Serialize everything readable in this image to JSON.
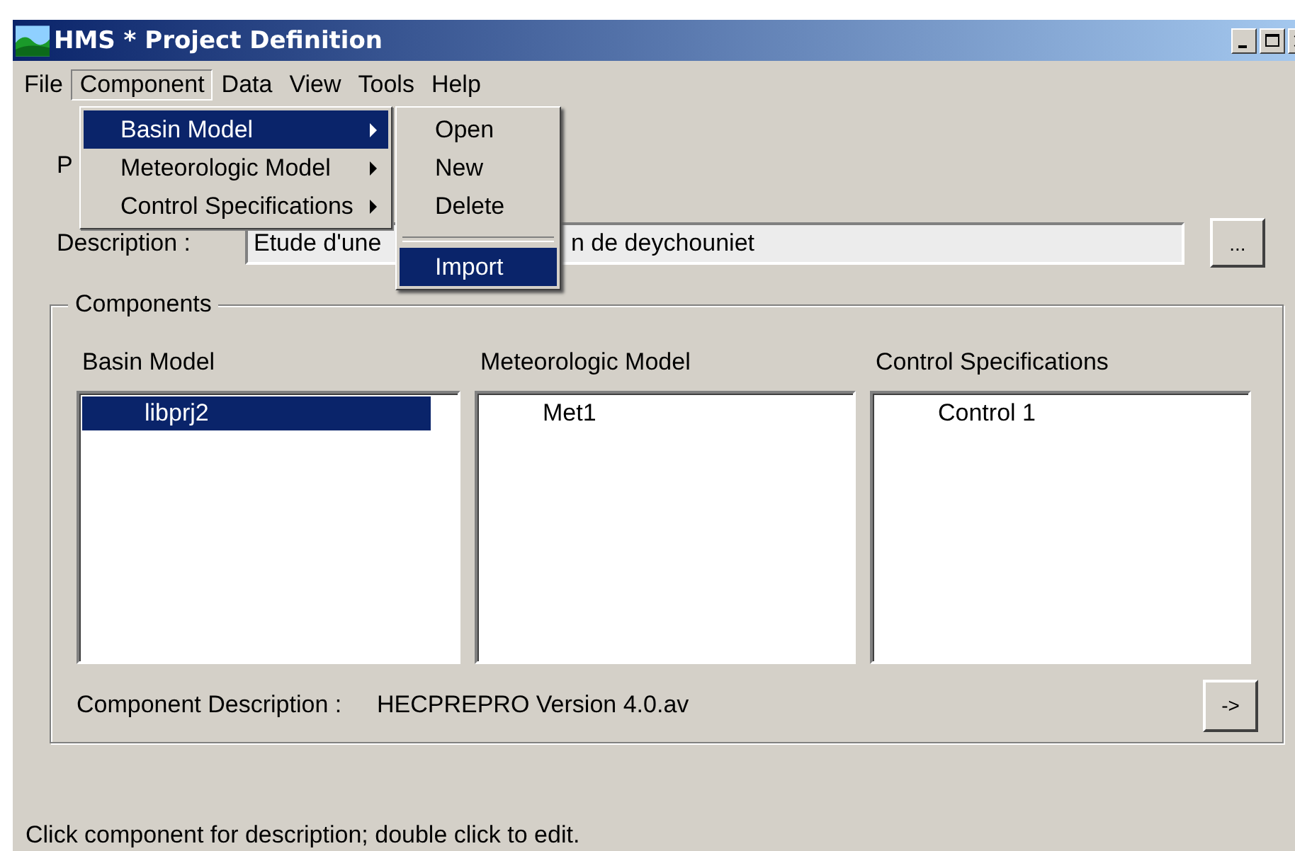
{
  "window": {
    "title": "HMS * Project Definition"
  },
  "menu_bar": [
    {
      "label": "File",
      "selected": false
    },
    {
      "label": "Component",
      "selected": true
    },
    {
      "label": "Data",
      "selected": false
    },
    {
      "label": "View",
      "selected": false
    },
    {
      "label": "Tools",
      "selected": false
    },
    {
      "label": "Help",
      "selected": false
    }
  ],
  "component_menu": [
    {
      "label": "Basin Model",
      "selected": true
    },
    {
      "label": "Meteorologic Model",
      "selected": false
    },
    {
      "label": "Control Specifications",
      "selected": false
    }
  ],
  "submenu": [
    {
      "kind": "item",
      "label": "Open",
      "selected": false
    },
    {
      "kind": "item",
      "label": "New",
      "selected": false
    },
    {
      "kind": "item",
      "label": "Delete",
      "selected": false
    },
    {
      "kind": "separator"
    },
    {
      "kind": "item",
      "label": "Import",
      "selected": true
    }
  ],
  "project_label": "P",
  "description": {
    "label": "Description :",
    "value_parts": [
      "Etude d'une",
      "n de deychouniet"
    ]
  },
  "browse_button": "...",
  "components": {
    "title": "Components",
    "lists": [
      {
        "header": "Basin Model",
        "items": [
          {
            "label": "libprj2",
            "selected": true
          }
        ]
      },
      {
        "header": "Meteorologic Model",
        "items": [
          {
            "label": "Met1",
            "selected": false
          }
        ]
      },
      {
        "header": "Control Specifications",
        "items": [
          {
            "label": "Control 1",
            "selected": false
          }
        ]
      }
    ]
  },
  "component_description": {
    "label": "Component Description :",
    "value": "HECPREPRO Version 4.0.av"
  },
  "next_button": "->",
  "status_bar": "Click component for description; double click to edit."
}
